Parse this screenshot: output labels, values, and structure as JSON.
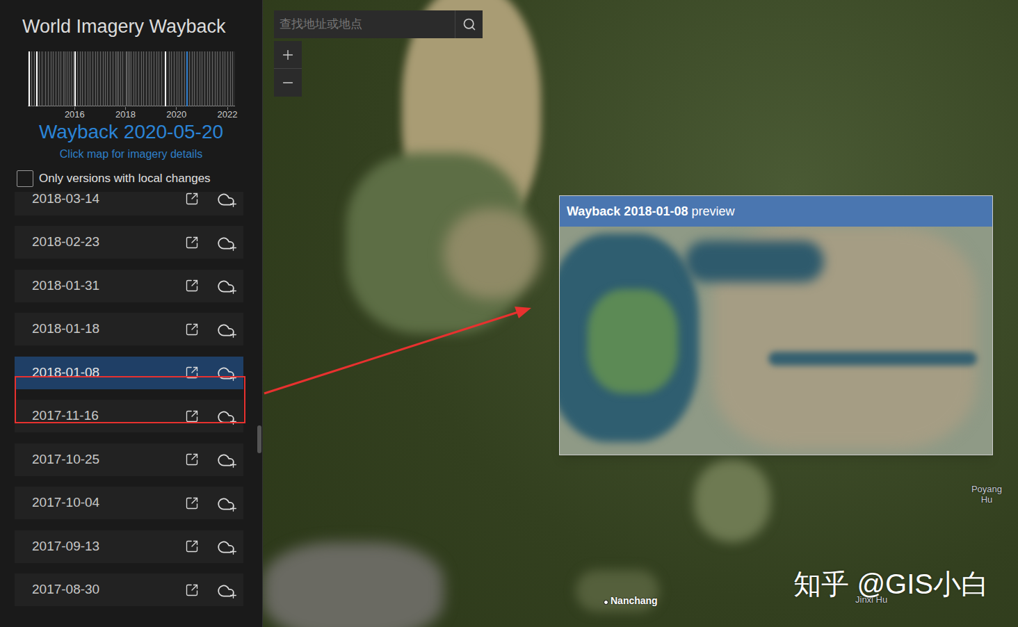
{
  "sidebar": {
    "title_light": "World Imagery",
    "title_bold": "Wayback",
    "timeline": {
      "ticks": [
        "2016",
        "2018",
        "2020",
        "2022"
      ],
      "start": 2014.16,
      "end": 2022.3,
      "releases": [
        2014.2,
        2014.3,
        2014.4,
        2014.6,
        2014.7,
        2014.85,
        2014.95,
        2015.05,
        2015.15,
        2015.25,
        2015.35,
        2015.45,
        2015.55,
        2015.62,
        2015.7,
        2015.78,
        2015.86,
        2015.94,
        2016.1,
        2016.2,
        2016.3,
        2016.4,
        2016.5,
        2016.6,
        2016.7,
        2016.8,
        2016.9,
        2017.0,
        2017.1,
        2017.2,
        2017.28,
        2017.38,
        2017.5,
        2017.6,
        2017.66,
        2017.72,
        2017.78,
        2017.88,
        2018.02,
        2018.05,
        2018.08,
        2018.15,
        2018.2,
        2018.3,
        2018.4,
        2018.5,
        2018.6,
        2018.7,
        2018.8,
        2018.9,
        2019.0,
        2019.1,
        2019.2,
        2019.3,
        2019.4,
        2019.7,
        2019.8,
        2019.9,
        2020.0,
        2020.1,
        2020.2,
        2020.3,
        2020.5,
        2020.6,
        2020.7,
        2020.8,
        2020.9,
        2021.0,
        2021.1,
        2021.2,
        2021.3,
        2021.4,
        2021.5,
        2021.6,
        2021.7,
        2021.8,
        2021.9,
        2022.0,
        2022.1,
        2022.2
      ],
      "highlighted": [
        2014.2,
        2014.5,
        2016.0,
        2019.53
      ],
      "selected": 2020.38
    },
    "current_version": "Wayback 2020-05-20",
    "hint": "Click map for imagery details",
    "filter": {
      "label": "Only versions with local changes",
      "checked": false
    },
    "versions": [
      {
        "date": "2018-03-14",
        "selected": false
      },
      {
        "date": "2018-02-23",
        "selected": false
      },
      {
        "date": "2018-01-31",
        "selected": false
      },
      {
        "date": "2018-01-18",
        "selected": false
      },
      {
        "date": "2018-01-08",
        "selected": true
      },
      {
        "date": "2017-11-16",
        "selected": false
      },
      {
        "date": "2017-10-25",
        "selected": false
      },
      {
        "date": "2017-10-04",
        "selected": false
      },
      {
        "date": "2017-09-13",
        "selected": false
      },
      {
        "date": "2017-08-30",
        "selected": false
      }
    ]
  },
  "map": {
    "search": {
      "placeholder": "查找地址或地点"
    },
    "labels": [
      "Poyang Hu",
      "Poyang Hu",
      "Nanchang",
      "Jinxi Hu"
    ],
    "preview": {
      "version": "Wayback 2018-01-08",
      "suffix": "preview"
    },
    "watermark": "知乎 @GIS小白"
  }
}
